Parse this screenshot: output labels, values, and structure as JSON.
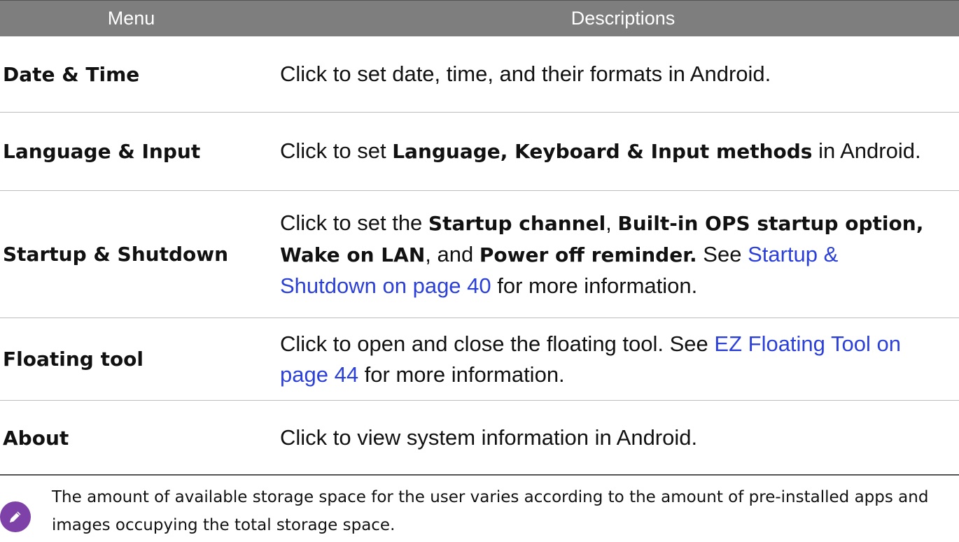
{
  "table": {
    "header": {
      "menu": "Menu",
      "descriptions": "Descriptions"
    },
    "rows": [
      {
        "menu": "Date & Time",
        "desc": {
          "text": "Click to set date, time, and their formats in Android."
        }
      },
      {
        "menu": "Language & Input",
        "desc": {
          "pre": "Click to set ",
          "bold": "Language, Keyboard & Input methods",
          "post": " in Android."
        }
      },
      {
        "menu": "Startup & Shutdown",
        "desc": {
          "pre": "Click to set the ",
          "bold1": "Startup channel",
          "sep1": ", ",
          "bold2": "Built-in OPS startup option, Wake on LAN",
          "sep2": ", and ",
          "bold3": "Power off reminder.",
          "see": " See ",
          "link": "Startup & Shutdown on page 40",
          "post": " for more information."
        }
      },
      {
        "menu": "Floating tool",
        "desc": {
          "pre": "Click to open and close the floating tool. See ",
          "link": "EZ Floating Tool on page 44",
          "post": " for more information."
        }
      },
      {
        "menu": "About",
        "desc": {
          "text": "Click to view system information in Android."
        }
      }
    ]
  },
  "note": {
    "icon": "pencil-icon",
    "text": "The amount of available storage space for the user varies according to the amount of pre-installed apps and images occupying the total storage space."
  },
  "colors": {
    "header_bg": "#7e7e7e",
    "link": "#2b3fd9",
    "note_icon": "#7e41a8"
  }
}
